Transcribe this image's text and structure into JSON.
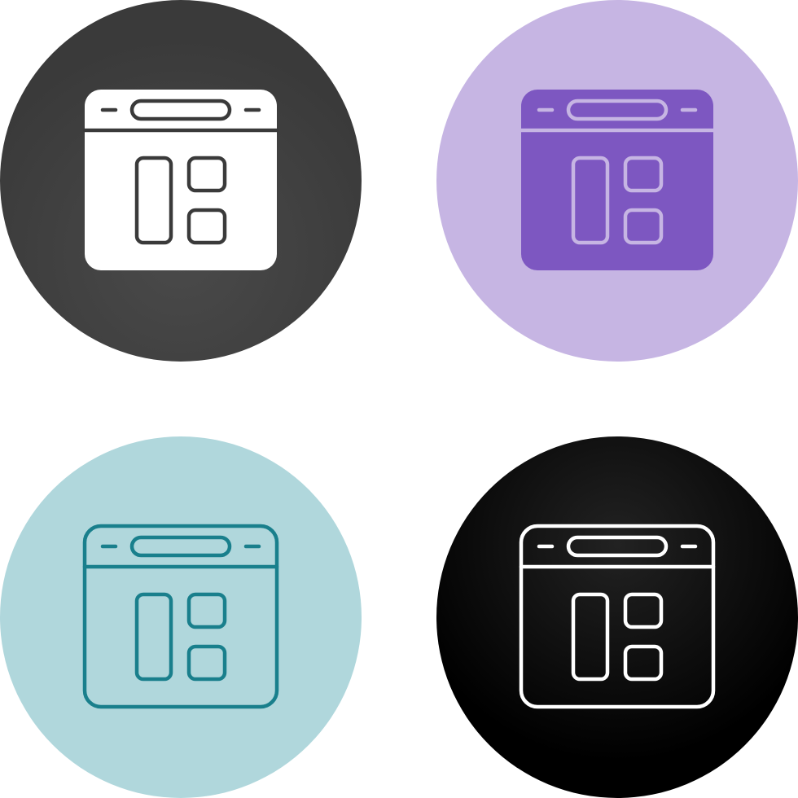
{
  "icon_set": {
    "icon_name": "browser-layout-icon",
    "variants": [
      {
        "id": "dark",
        "style": "glyph",
        "circle_color": "#3a3a3a",
        "circle_color_light": "#4a4a4a",
        "window_fill": "#ffffff",
        "line_color": "#3a3a3a"
      },
      {
        "id": "purple",
        "style": "duotone",
        "circle_color": "#c6b5e3",
        "window_fill": "#7d57c1",
        "header_fill": "#7d57c1",
        "line_color": "#c6b5e3"
      },
      {
        "id": "teal",
        "style": "outline",
        "circle_color": "#b0d7dc",
        "window_fill": "none",
        "line_color": "#197f8c"
      },
      {
        "id": "black",
        "style": "outline",
        "circle_color": "#000000",
        "circle_color_light": "#222222",
        "window_fill": "none",
        "line_color": "#ffffff"
      }
    ]
  }
}
